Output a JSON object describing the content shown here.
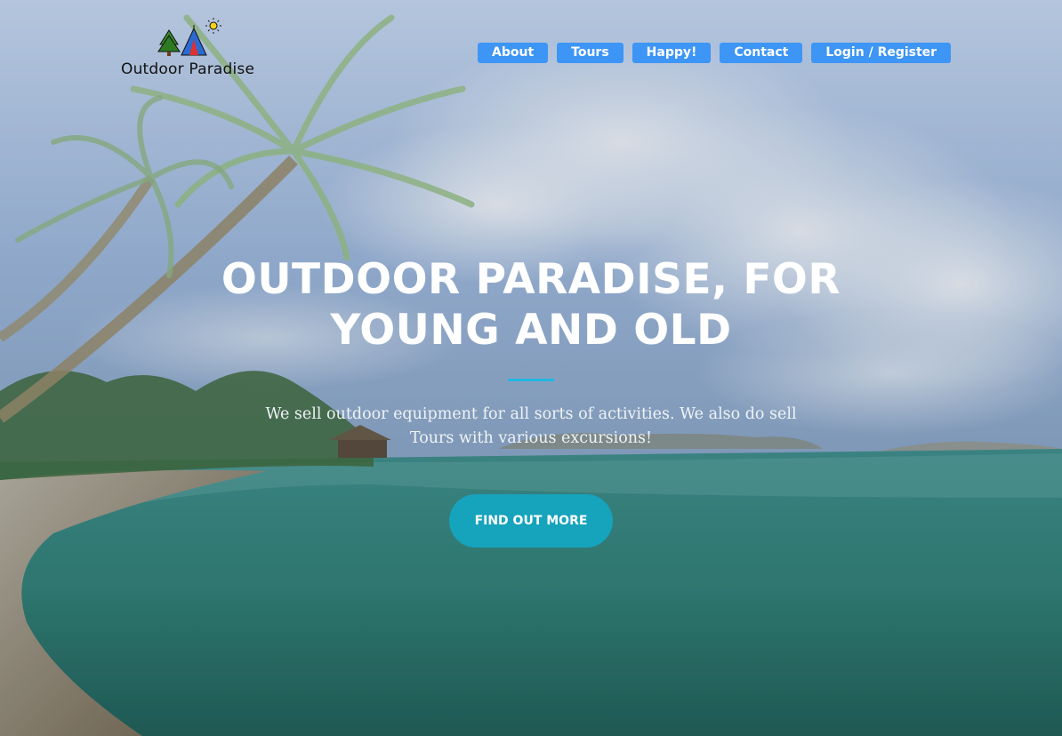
{
  "brand": {
    "name": "Outdoor Paradise",
    "logo_icons": [
      "pine-tree-icon",
      "tent-icon",
      "sun-icon"
    ]
  },
  "nav": {
    "items": [
      {
        "label": "About"
      },
      {
        "label": "Tours"
      },
      {
        "label": "Happy!"
      },
      {
        "label": "Contact"
      },
      {
        "label": "Login / Register"
      }
    ],
    "button_color": "#3d95f5"
  },
  "hero": {
    "headline_line1": "OUTDOOR PARADISE, FOR",
    "headline_line2": "YOUNG AND OLD",
    "subtext_line1": "We sell outdoor equipment for all sorts of activities. We also do sell",
    "subtext_line2": "Tours with various excursions!",
    "cta_label": "FIND OUT MORE",
    "accent_color": "#22b6e0",
    "cta_color": "#16a3bc",
    "background": "tropical-beach-photo"
  }
}
